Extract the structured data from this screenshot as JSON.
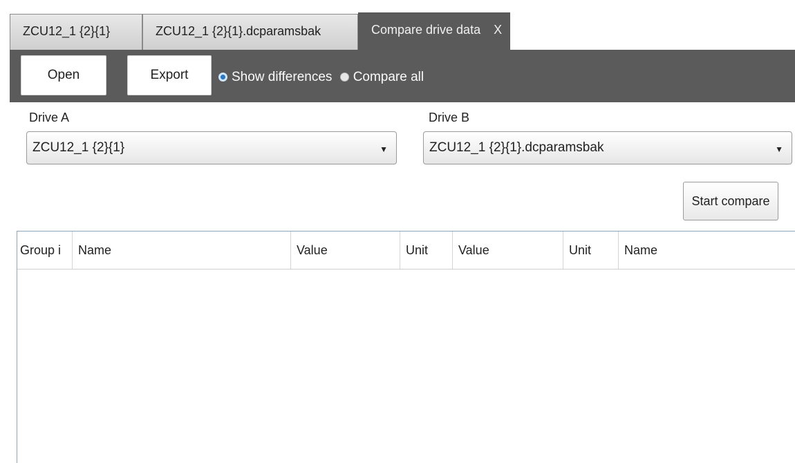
{
  "tabs": [
    {
      "label": "ZCU12_1 {2}{1}"
    },
    {
      "label": "ZCU12_1 {2}{1}.dcparamsbak"
    },
    {
      "label": "Compare drive data",
      "close": "X"
    }
  ],
  "toolbar": {
    "open_label": "Open",
    "export_label": "Export",
    "show_differences_label": "Show differences",
    "compare_all_label": "Compare all",
    "selected_mode": "Show differences"
  },
  "drive_a": {
    "label": "Drive A",
    "selected": "ZCU12_1 {2}{1}"
  },
  "drive_b": {
    "label": "Drive B",
    "selected": "ZCU12_1 {2}{1}.dcparamsbak"
  },
  "start_compare_label": "Start compare",
  "table": {
    "columns": [
      "Group i",
      "Name",
      "Value",
      "Unit",
      "Value",
      "Unit",
      "Name"
    ],
    "rows": []
  },
  "colors": {
    "toolbar_bg": "#5b5b5b",
    "active_tab_bg": "#5a5a5a",
    "radio_selected": "#2a78c2",
    "table_border": "#8aa4bd"
  }
}
